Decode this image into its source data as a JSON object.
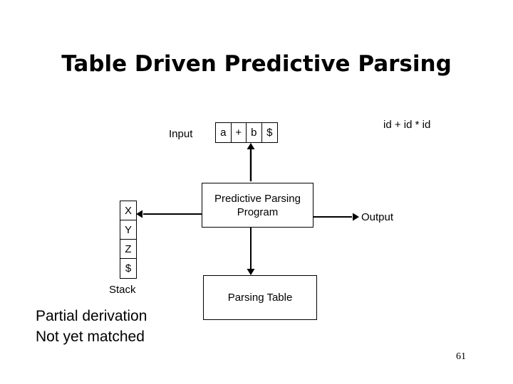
{
  "slide": {
    "title": "Table Driven Predictive Parsing",
    "page_number": "61",
    "background_color": "#ffffff",
    "ink_color": "#000000"
  },
  "input_section": {
    "label": "Input",
    "buffer_cells": [
      "a",
      "+",
      "b",
      "$"
    ],
    "lookahead_cell_index": 2,
    "lookahead_arrow_icon": "arrow-up-icon"
  },
  "token_stream": {
    "text": "id + id * id"
  },
  "stack_section": {
    "label": "Stack",
    "cells": [
      "X",
      "Y",
      "Z",
      "$"
    ],
    "incoming_arrow_icon": "arrow-left-icon"
  },
  "program_box": {
    "line1": "Predictive Parsing",
    "line2": "Program"
  },
  "table_box": {
    "label": "Parsing Table",
    "incoming_arrow_icon": "arrow-down-icon"
  },
  "output_section": {
    "label": "Output",
    "arrow_icon": "arrow-right-icon"
  },
  "note": {
    "line1": "Partial derivation",
    "line2": "Not yet matched"
  }
}
